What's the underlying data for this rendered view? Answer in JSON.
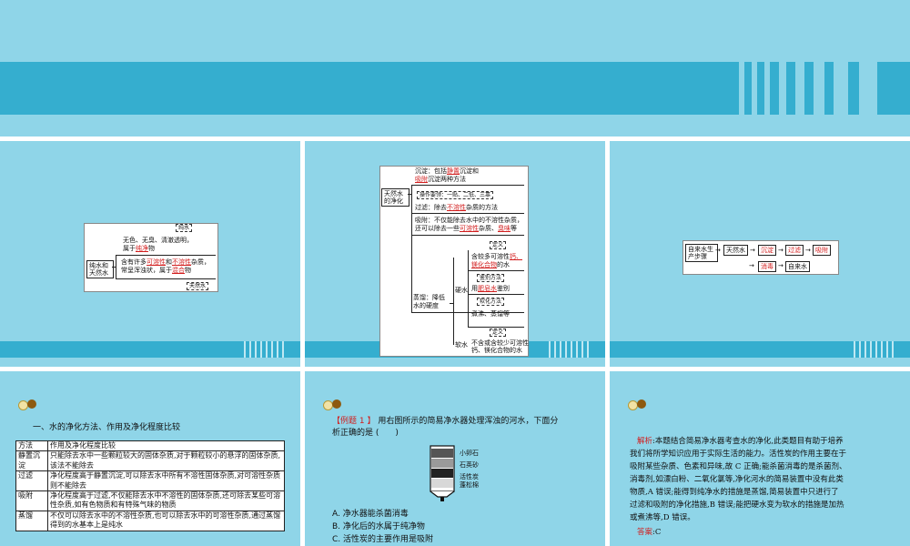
{
  "slide2": {
    "left_label": "纯水和天然水",
    "top_tag": "纯水",
    "top_text_1": "无色、无臭、清澈透明，",
    "top_text_2_pre": "属于",
    "top_text_2_red": "纯净",
    "top_text_2_post": "物",
    "bottom_text_1_pre": "含有许多",
    "bottom_text_1_red1": "可溶性",
    "bottom_text_1_mid": "和",
    "bottom_text_1_red2": "不溶性",
    "bottom_text_1_post": "杂质，",
    "bottom_text_2_pre": "常呈浑浊状，属于",
    "bottom_text_2_red": "混合",
    "bottom_text_2_post": "物",
    "bottom_tag": "天然水"
  },
  "slide3": {
    "root": "天然水的净化",
    "sediment_1_pre": "沉淀：包括",
    "sediment_1_red": "静置",
    "sediment_1_post": "沉淀和",
    "sediment_2_red": "吸附",
    "sediment_2_post": "沉淀两种方法",
    "filter_tag": "操作要领：一贴、二低、三靠",
    "filter_pre": "过滤：除去",
    "filter_red": "不溶性",
    "filter_post": "杂质的方法",
    "adsorb_1": "吸附：不仅能除去水中的不溶性杂质，",
    "adsorb_2_pre": "还可以除去一些",
    "adsorb_2_red1": "可溶性",
    "adsorb_2_mid": "杂质、",
    "adsorb_2_red2": "臭味",
    "adsorb_2_post": "等",
    "distill": "蒸馏：降低水的硬度",
    "hard_water": "硬水",
    "soft_water": "软水",
    "def_tag_1": "定义",
    "hard_def_1_pre": "含较多可溶性",
    "hard_def_1_red": "钙、",
    "hard_def_2_red": "镁化合物",
    "hard_def_2_post": "的水",
    "identify_tag": "鉴别方法",
    "identify_pre": "用",
    "identify_red": "肥皂水",
    "identify_post": "鉴别",
    "soften_tag": "软化方法",
    "soften_text": "煮沸、蒸馏等",
    "def_tag_2": "定义",
    "soft_def_1": "不含或含较少可溶性",
    "soft_def_2": "钙、镁化合物的水"
  },
  "slide4": {
    "start": "自来水生产步骤",
    "step1": "天然水",
    "step2": "沉淀",
    "step3": "过滤",
    "step4": "吸附",
    "step5": "消毒",
    "step6": "自来水"
  },
  "slide5": {
    "heading": "一、水的净化方法、作用及净化程度比较",
    "col1": "方法",
    "col2": "作用及净化程度比较",
    "rows": [
      {
        "method": "静置沉淀",
        "desc": "只能除去水中一些颗粒较大的固体杂质,对于颗粒较小的悬浮的固体杂质,该法不能除去"
      },
      {
        "method": "过滤",
        "desc": "净化程度高于静置沉淀,可以除去水中所有不溶性固体杂质,对可溶性杂质则不能除去"
      },
      {
        "method": "吸附",
        "desc": "净化程度高于过滤,不仅能除去水中不溶性的固体杂质,还可除去某些可溶性杂质,如有色物质和有特殊气味的物质"
      },
      {
        "method": "蒸馏",
        "desc": "不仅可以除去水中的不溶性杂质,也可以除去水中的可溶性杂质,通过蒸馏得到的水基本上是纯水"
      }
    ]
  },
  "slide6": {
    "tag": "【例题 1 】",
    "question_1": "用右图所示的简易净水器处理浑浊的河水，下面分",
    "question_2": "析正确的是 (　　)",
    "labels": [
      "小卵石",
      "石英砂",
      "活性炭",
      "蓬松棉"
    ],
    "options": [
      "A. 净水器能杀菌消毒",
      "B. 净化后的水属于纯净物",
      "C. 活性炭的主要作用是吸附"
    ]
  },
  "slide7": {
    "analysis_label": "解析",
    "analysis_lines": [
      ":本题结合简易净水器考查水的净化,此类题目有助于培养",
      "我们将所学知识应用于实际生活的能力。活性炭的作用主要在于",
      "吸附某些杂质、色素和异味,故 C 正确;能杀菌消毒的是杀菌剂、",
      "消毒剂,如漂白粉、二氧化氯等,净化河水的简易装置中没有此类",
      "物质,A 错误;能得到纯净水的措施是蒸馏,简易装置中只进行了",
      "过滤和吸附的净化措施,B 错误;能把硬水变为软水的措施是加热",
      "或煮沸等,D 错误。"
    ],
    "answer_label": "答案",
    "answer_value": ":C"
  },
  "colors": {
    "sky": "#8fd5e8",
    "band": "#35aecf",
    "red": "#d21e1e"
  }
}
